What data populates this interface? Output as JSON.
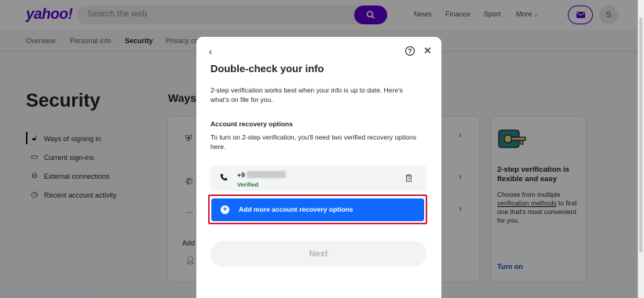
{
  "header": {
    "logo": "yahoo!",
    "search_placeholder": "Search the web",
    "nav": [
      "News",
      "Finance",
      "Sport",
      "More"
    ],
    "avatar_letter": "S"
  },
  "subnav": {
    "tabs": [
      "Overview",
      "Personal info",
      "Security",
      "Privacy co"
    ]
  },
  "page": {
    "heading": "Security",
    "section_heading": "Ways",
    "add_label": "Add",
    "sidebar": [
      "Ways of signing in",
      "Current sign-ins",
      "External connections",
      "Recent account activity"
    ]
  },
  "promo": {
    "title": "2-step verification is flexible and easy",
    "desc_before": "Choose from multiple ",
    "desc_link": "verification methods",
    "desc_after": " to find one that's most convenient for you.",
    "cta": "Turn on"
  },
  "modal": {
    "title": "Double-check your info",
    "intro": "2-step verification works best when your info is up to date. Here's what's on file for you.",
    "section_title": "Account recovery options",
    "section_desc": "To turn on 2-step verification, you'll need two verified recovery options here.",
    "phone_prefix": "+9",
    "phone_status": "Verified",
    "add_button": "Add more account recovery options",
    "next_button": "Next",
    "help_glyph": "?"
  },
  "colors": {
    "brand": "#6001d2",
    "primary_button": "#0f69ff",
    "highlight_outline": "#d4213d",
    "verified": "#1c7a3a"
  },
  "icons": [
    "search-icon",
    "mail-icon",
    "back-icon",
    "help-icon",
    "close-icon",
    "phone-icon",
    "trash-icon",
    "plus-icon",
    "lock-icon",
    "monitor-icon",
    "link-icon",
    "clock-icon",
    "shield-icon",
    "chevron-right-icon",
    "key-illustration"
  ]
}
